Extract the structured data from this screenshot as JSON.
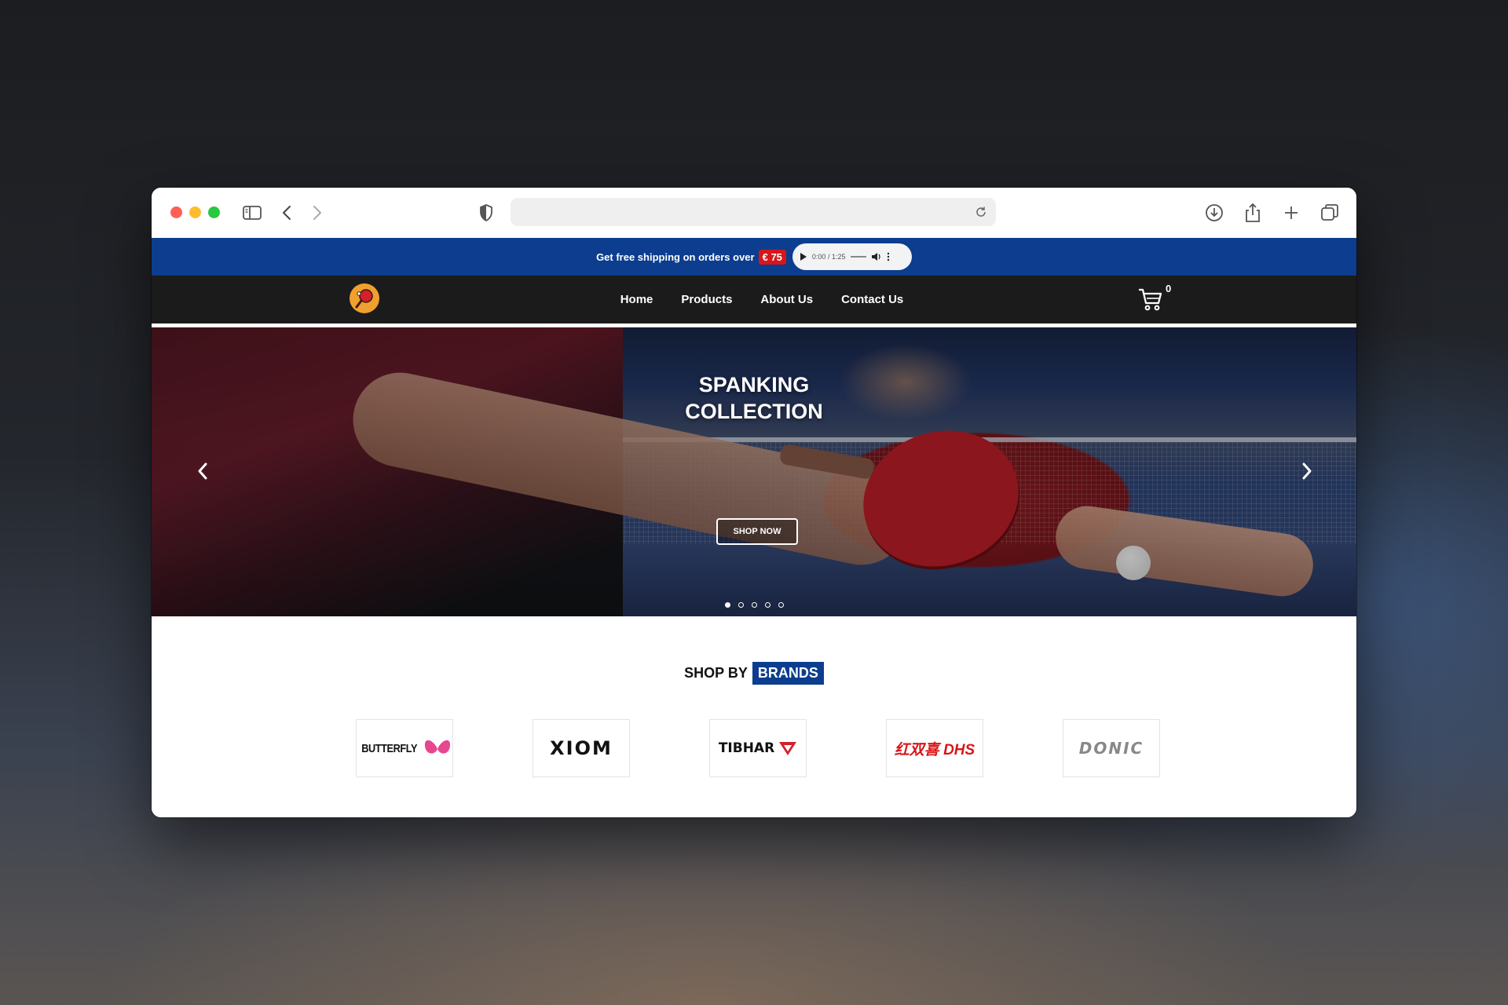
{
  "promo": {
    "text": "Get free shipping on orders over",
    "price": "€ 75",
    "audio_time": "0:00 / 1:25"
  },
  "nav": {
    "links": [
      "Home",
      "Products",
      "About Us",
      "Contact Us"
    ],
    "cart_count": "0"
  },
  "hero": {
    "title_line1": "SPANKING",
    "title_line2": "COLLECTION",
    "button_label": "SHOP NOW",
    "slide_count": 5,
    "active_slide": 1
  },
  "brands": {
    "title_prefix": "SHOP BY",
    "title_highlight": "BRANDS",
    "items": [
      "BUTTERFLY",
      "XIOM",
      "TIBHAR",
      "红双喜 DHS",
      "DONIC"
    ]
  },
  "colors": {
    "promo_bg": "#0c3d8e",
    "price_badge": "#d7161b",
    "navbar_bg": "#1b1b1b"
  }
}
